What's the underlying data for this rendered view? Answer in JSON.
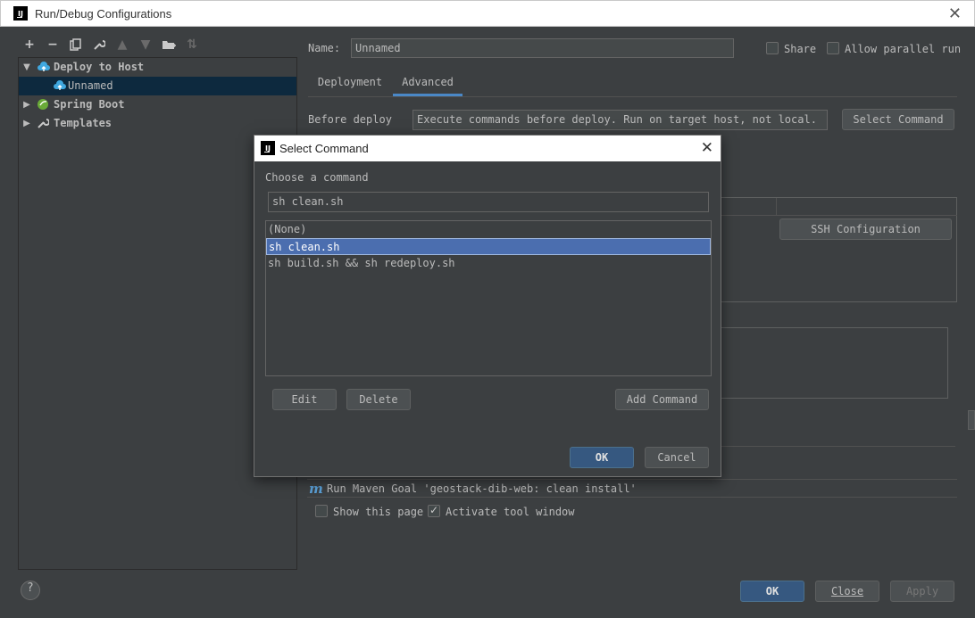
{
  "window": {
    "title": "Run/Debug Configurations",
    "logo": "IJ",
    "close_icon": "close-icon"
  },
  "toolbar": {
    "icons": [
      "add-icon",
      "remove-icon",
      "copy-icon",
      "wrench-icon",
      "move-up-icon",
      "move-down-icon",
      "folder-icon",
      "sort-icon"
    ]
  },
  "tree": {
    "items": [
      {
        "label": "Deploy to Host",
        "expanded": true
      },
      {
        "label": "Unnamed",
        "selected": true
      },
      {
        "label": "Spring Boot",
        "expanded": false
      },
      {
        "label": "Templates",
        "expanded": false
      }
    ]
  },
  "config": {
    "name_label": "Name:",
    "name_value": "Unnamed",
    "share_label": "Share",
    "allow_parallel_label": "Allow parallel run",
    "tabs": [
      "Deployment",
      "Advanced"
    ],
    "active_tab": "Advanced",
    "before_deploy_label": "Before deploy",
    "before_deploy_placeholder": "Execute commands before deploy. Run on target host, not local.",
    "select_command_label": "Select Command",
    "ssh_config_label": "SSH Configuration",
    "maven_goal": "Run Maven Goal 'geostack-dib-web: clean install'",
    "show_page_label": "Show this page",
    "show_page_checked": false,
    "activate_tool_label": "Activate tool window",
    "activate_tool_checked": true
  },
  "footer": {
    "ok": "OK",
    "close": "Close",
    "apply": "Apply",
    "help": "?"
  },
  "dialog": {
    "title": "Select Command",
    "logo": "IJ",
    "choose_label": "Choose a command",
    "input_value": "sh clean.sh",
    "options": [
      "(None)",
      "sh clean.sh",
      "sh build.sh && sh redeploy.sh"
    ],
    "selected_index": 1,
    "edit": "Edit",
    "delete": "Delete",
    "add_command": "Add Command",
    "ok": "OK",
    "cancel": "Cancel"
  },
  "colors": {
    "background": "#3c3f41",
    "accent": "#4a88c7",
    "selection": "#4b6eaf",
    "primary_button": "#365880"
  }
}
